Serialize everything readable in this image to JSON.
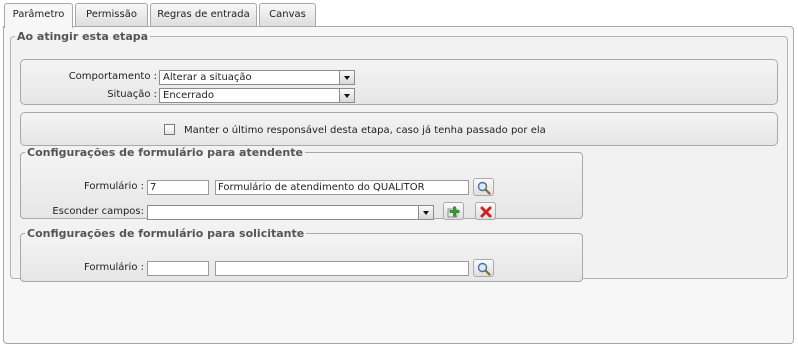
{
  "tabs": [
    {
      "label": "Parâmetro",
      "active": true
    },
    {
      "label": "Permissão",
      "active": false
    },
    {
      "label": "Regras de entrada",
      "active": false
    },
    {
      "label": "Canvas",
      "active": false
    }
  ],
  "main": {
    "legend": "Ao atingir esta etapa",
    "behavior": {
      "comportamento_label": "Comportamento :",
      "comportamento_value": "Alterar a situação",
      "situacao_label": "Situação :",
      "situacao_value": "Encerrado"
    },
    "keep_responsible": {
      "checked": false,
      "label": "Manter o último responsável desta etapa, caso já tenha passado por ela"
    },
    "attendant_form": {
      "legend": "Configurações de formulário para atendente",
      "form_label": "Formulário :",
      "form_code": "7",
      "form_name": "Formulário de atendimento do QUALITOR",
      "hide_fields_label": "Esconder campos:",
      "hide_fields_value": ""
    },
    "requester_form": {
      "legend": "Configurações de formulário para solicitante",
      "form_label": "Formulário :",
      "form_code": "",
      "form_name": ""
    }
  },
  "icons": {
    "search": "magnifier-icon",
    "add": "add-green-plus-icon",
    "remove": "red-x-icon"
  }
}
